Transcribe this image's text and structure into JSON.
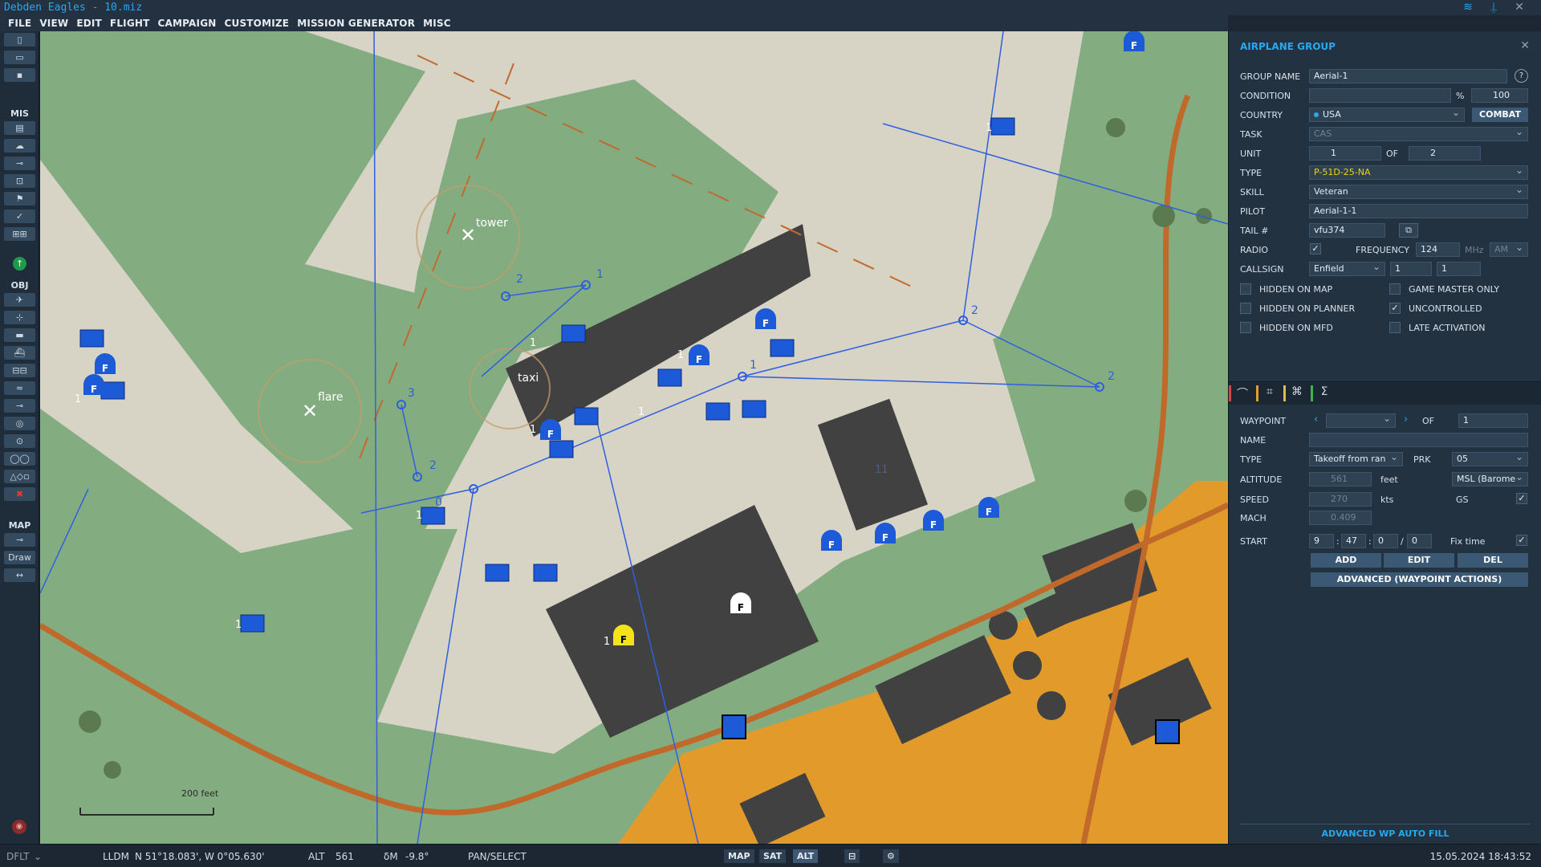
{
  "window": {
    "title": "Debden Eagles - 10.miz"
  },
  "menu": [
    "FILE",
    "VIEW",
    "EDIT",
    "FLIGHT",
    "CAMPAIGN",
    "CUSTOMIZE",
    "MISSION GENERATOR",
    "MISC"
  ],
  "toolbar": {
    "sections": {
      "mis": "MIS",
      "obj": "OBJ",
      "map": "MAP"
    },
    "draw_label": "Draw"
  },
  "map": {
    "labels": {
      "tower": "tower",
      "flare": "flare",
      "taxi": "taxi",
      "scale": "200 feet",
      "building_number": "11"
    },
    "unit_symbol_letter": "F",
    "group_count": "1",
    "waypoint_numbers": [
      "0",
      "1",
      "2",
      "3"
    ],
    "colors": {
      "grass": "#83ad80",
      "runway": "#d7d4c6",
      "asphalt": "#414141",
      "road": "#c0692b",
      "town": "#e29a2a",
      "blue_unit": "#1c5ad8",
      "route": "#2f5fe0",
      "selected": "#f5e21a",
      "neutral": "#ffffff"
    }
  },
  "panel": {
    "title": "AIRPLANE GROUP",
    "group_name": {
      "label": "GROUP NAME",
      "value": "Aerial-1",
      "help": "?"
    },
    "condition": {
      "label": "CONDITION",
      "unit": "%",
      "value": "100"
    },
    "country": {
      "label": "COUNTRY",
      "value": "USA",
      "button": "COMBAT"
    },
    "task": {
      "label": "TASK",
      "value": "CAS"
    },
    "unit": {
      "label": "UNIT",
      "value": "1",
      "of_label": "OF",
      "of_value": "2"
    },
    "type": {
      "label": "TYPE",
      "value": "P-51D-25-NA"
    },
    "skill": {
      "label": "SKILL",
      "value": "Veteran"
    },
    "pilot": {
      "label": "PILOT",
      "value": "Aerial-1-1"
    },
    "tail": {
      "label": "TAIL #",
      "value": "vfu374"
    },
    "radio": {
      "label": "RADIO",
      "checked": "✓",
      "freq_label": "FREQUENCY",
      "freq_value": "124",
      "freq_unit": "MHz",
      "modulation": "AM"
    },
    "callsign": {
      "label": "CALLSIGN",
      "name": "Enfield",
      "num1": "1",
      "num2": "1"
    },
    "checkboxes": [
      {
        "label": "HIDDEN ON MAP",
        "mark": ""
      },
      {
        "label": "GAME MASTER ONLY",
        "mark": ""
      },
      {
        "label": "HIDDEN ON PLANNER",
        "mark": ""
      },
      {
        "label": "UNCONTROLLED",
        "mark": "✓"
      },
      {
        "label": "HIDDEN ON MFD",
        "mark": ""
      },
      {
        "label": "LATE ACTIVATION",
        "mark": ""
      }
    ],
    "waypoint": {
      "label": "WAYPOINT",
      "of_label": "OF",
      "of_value": "1",
      "name_label": "NAME",
      "name_value": "",
      "type_label": "TYPE",
      "type_value": "Takeoff from ran",
      "prk_label": "PRK",
      "prk_value": "05",
      "altitude_label": "ALTITUDE",
      "altitude_value": "561",
      "altitude_unit": "feet",
      "altitude_ref": "MSL (Barome",
      "speed_label": "SPEED",
      "speed_value": "270",
      "speed_unit": "kts",
      "speed_ref": "GS",
      "speed_check": "✓",
      "mach_label": "MACH",
      "mach_value": "0.409",
      "start_label": "START",
      "start_h": "9",
      "start_m": "47",
      "start_s": "0",
      "start_d": "0",
      "fix_label": "Fix time",
      "fix_check": "✓",
      "add": "ADD",
      "edit": "EDIT",
      "del": "DEL",
      "advanced": "ADVANCED (WAYPOINT ACTIONS)"
    },
    "auto_fill": "ADVANCED WP AUTO FILL"
  },
  "status": {
    "layer": "DFLT",
    "coord_system": "LLDM",
    "coords": "N 51°18.083', W 0°05.630'",
    "alt_label": "ALT",
    "alt_value": "561",
    "dm_label": "δM",
    "dm_value": "-9.8°",
    "mode": "PAN/SELECT",
    "map_btn": "MAP",
    "sat_btn": "SAT",
    "alt_btn": "ALT",
    "datetime": "15.05.2024 18:43:52"
  }
}
